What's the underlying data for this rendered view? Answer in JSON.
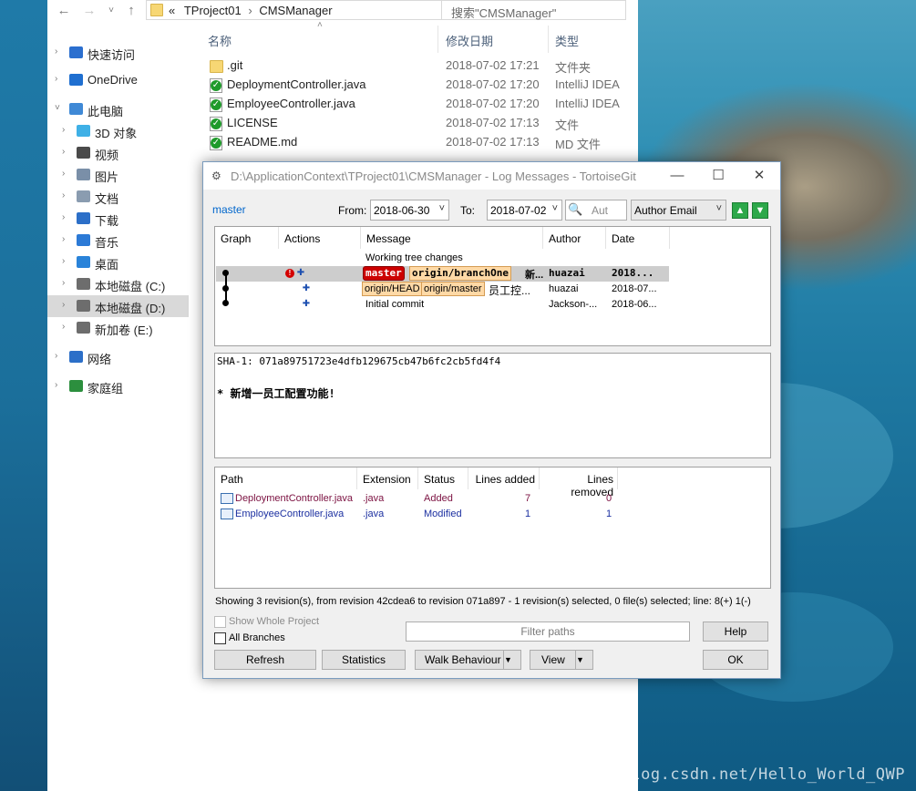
{
  "explorer": {
    "breadcrumb": [
      "«",
      "TProject01",
      "›",
      "CMSManager"
    ],
    "search_placeholder": "搜索\"CMSManager\"",
    "columns": {
      "name": "名称",
      "date": "修改日期",
      "type": "类型"
    },
    "files": [
      {
        "name": ".git",
        "date": "2018-07-02 17:21",
        "type": "文件夹",
        "icon": "folder-icon"
      },
      {
        "name": "DeploymentController.java",
        "date": "2018-07-02 17:20",
        "type": "IntelliJ IDEA",
        "icon": "java-file-ok-icon"
      },
      {
        "name": "EmployeeController.java",
        "date": "2018-07-02 17:20",
        "type": "IntelliJ IDEA",
        "icon": "java-file-ok-icon"
      },
      {
        "name": "LICENSE",
        "date": "2018-07-02 17:13",
        "type": "文件",
        "icon": "file-ok-icon"
      },
      {
        "name": "README.md",
        "date": "2018-07-02 17:13",
        "type": "MD 文件",
        "icon": "file-ok-icon"
      }
    ],
    "sidebar": [
      {
        "label": "快速访问",
        "icon": "star-icon",
        "color": "#2b6fcf"
      },
      {
        "label": "OneDrive",
        "icon": "cloud-icon",
        "color": "#1f6fd0"
      },
      {
        "label": "此电脑",
        "icon": "computer-icon",
        "color": "#3f89d6"
      },
      {
        "label": "3D 对象",
        "icon": "cube-icon",
        "color": "#3fb0e6"
      },
      {
        "label": "视频",
        "icon": "video-icon",
        "color": "#4a4a4a"
      },
      {
        "label": "图片",
        "icon": "picture-icon",
        "color": "#7a8fa8"
      },
      {
        "label": "文档",
        "icon": "document-icon",
        "color": "#8a9cb0"
      },
      {
        "label": "下载",
        "icon": "download-icon",
        "color": "#2c6fc8"
      },
      {
        "label": "音乐",
        "icon": "music-icon",
        "color": "#2c7ad6"
      },
      {
        "label": "桌面",
        "icon": "desktop-icon",
        "color": "#2a83d9"
      },
      {
        "label": "本地磁盘 (C:)",
        "icon": "drive-icon",
        "color": "#6d6d6d"
      },
      {
        "label": "本地磁盘 (D:)",
        "icon": "drive-icon",
        "color": "#6d6d6d"
      },
      {
        "label": "新加卷 (E:)",
        "icon": "drive-icon",
        "color": "#6d6d6d"
      },
      {
        "label": "网络",
        "icon": "network-icon",
        "color": "#2c6fc8"
      },
      {
        "label": "家庭组",
        "icon": "homegroup-icon",
        "color": "#2c8f3e"
      }
    ]
  },
  "tg": {
    "title": "D:\\ApplicationContext\\TProject01\\CMSManager - Log Messages - TortoiseGit",
    "branch": "master",
    "from_label": "From:",
    "from_date": "2018-06-30",
    "to_label": "To:",
    "to_date": "2018-07-02",
    "search_placeholder": "Aut",
    "filter_field": "Author Email",
    "log_columns": [
      "Graph",
      "Actions",
      "Message",
      "Author",
      "Date"
    ],
    "log_rows": [
      {
        "message": "Working tree changes",
        "author": "",
        "date": ""
      },
      {
        "tags": [
          "master",
          "origin/branchOne"
        ],
        "message": "新...",
        "author": "huazai",
        "date": "2018..."
      },
      {
        "tags": [
          "origin/HEAD",
          "origin/master"
        ],
        "message": "员工控...",
        "author": "huazai",
        "date": "2018-07..."
      },
      {
        "message": "Initial commit",
        "author": "Jackson-...",
        "date": "2018-06..."
      }
    ],
    "detail": {
      "sha": "SHA-1: 071a89751723e4dfb129675cb47b6fc2cb5fd4f4",
      "body": "* 新增一员工配置功能!"
    },
    "file_columns": [
      "Path",
      "Extension",
      "Status",
      "Lines added",
      "Lines removed"
    ],
    "files": [
      {
        "path": "DeploymentController.java",
        "ext": ".java",
        "status": "Added",
        "added": "7",
        "removed": "0",
        "color": "#7b1040"
      },
      {
        "path": "EmployeeController.java",
        "ext": ".java",
        "status": "Modified",
        "added": "1",
        "removed": "1",
        "color": "#1b2fa0"
      }
    ],
    "status_line": "Showing 3 revision(s), from revision 42cdea6 to revision 071a897 - 1 revision(s) selected, 0 file(s) selected; line: 8(+) 1(-)",
    "show_whole_project": "Show Whole Project",
    "all_branches": "All Branches",
    "filter_placeholder": "Filter paths",
    "buttons": {
      "help": "Help",
      "refresh": "Refresh",
      "statistics": "Statistics",
      "walk": "Walk Behaviour",
      "view": "View",
      "ok": "OK"
    }
  },
  "watermark": "https://blog.csdn.net/Hello_World_QWP"
}
